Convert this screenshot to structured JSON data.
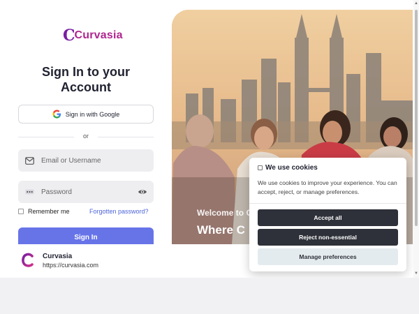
{
  "brand": {
    "logo_text": "Curvasia",
    "logo_mark": "C",
    "color_primary": "#7a1fa2",
    "color_accent": "#b0258f"
  },
  "signin": {
    "title": "Sign In to your Account",
    "google_button": "Sign in with Google",
    "divider_text": "or",
    "email_placeholder": "Email or Username",
    "password_placeholder": "Password",
    "remember_label": "Remember me",
    "forgot_link": "Forgotten password?",
    "submit_label": "Sign In"
  },
  "link_preview": {
    "name": "Curvasia",
    "url": "https://curvasia.com"
  },
  "hero": {
    "welcome": "Welcome to C",
    "headline": "Where C"
  },
  "cookies": {
    "title": "We use cookies",
    "body": "We use cookies to improve your experience. You can accept, reject, or manage preferences.",
    "accept": "Accept all",
    "reject": "Reject non-essential",
    "manage": "Manage preferences"
  },
  "icons": {
    "google": "google-icon",
    "email": "mail-icon",
    "password": "password-dots-icon",
    "eye": "eye-icon"
  },
  "colors": {
    "signin_button": "#6774e8",
    "cookie_button_dark": "#2e3139",
    "link": "#4b63d8"
  }
}
